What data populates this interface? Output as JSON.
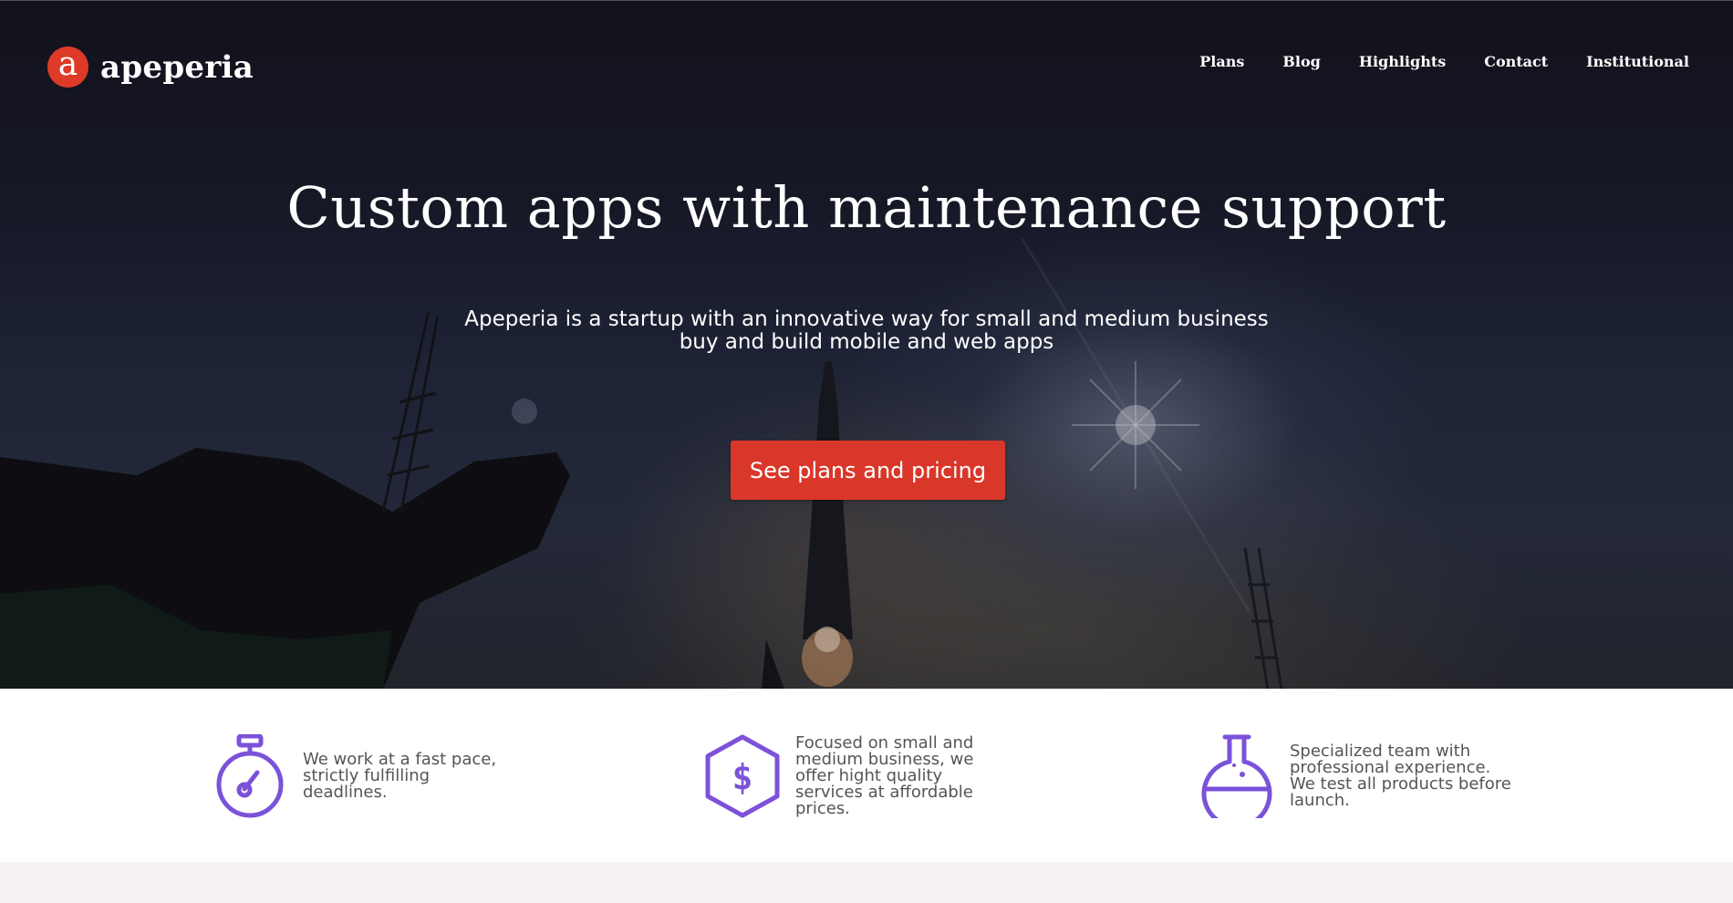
{
  "brand": {
    "logo_letter": "a",
    "name": "apeperia",
    "accent_color": "#dd3a28"
  },
  "nav": {
    "items": [
      {
        "label": "Plans"
      },
      {
        "label": "Blog"
      },
      {
        "label": "Highlights"
      },
      {
        "label": "Contact"
      },
      {
        "label": "Institutional"
      }
    ]
  },
  "hero": {
    "title": "Custom apps with maintenance support",
    "subtitle": "Apeperia is a startup with an innovative way for small and medium business buy and build mobile and web apps",
    "cta_label": "See plans and pricing",
    "cta_color": "#d9372a"
  },
  "features": {
    "icon_color": "#7b52d9",
    "items": [
      {
        "icon": "stopwatch-icon",
        "text": "We work at a fast pace, strictly fulfilling deadlines."
      },
      {
        "icon": "hexagon-dollar-icon",
        "text": "Focused on small and medium business, we offer hight quality services at affordable prices."
      },
      {
        "icon": "flask-icon",
        "text": "Specialized team with professional experience. We test all products before launch."
      }
    ]
  }
}
